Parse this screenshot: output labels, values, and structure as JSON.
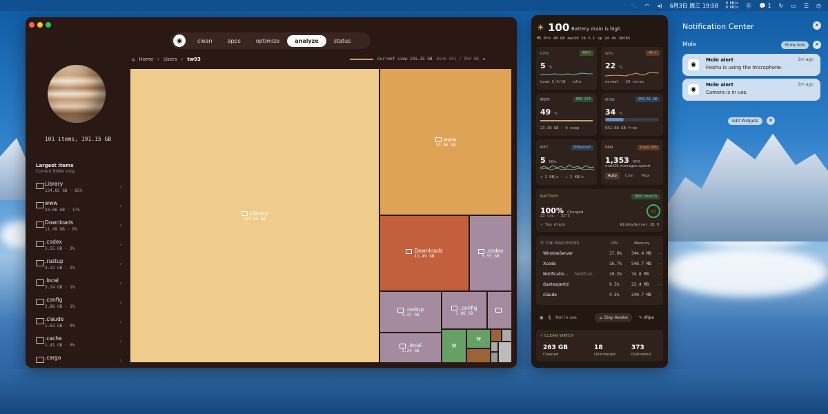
{
  "menubar": {
    "date": "6月3日 周三 19:58",
    "net_up": "0 KB/s",
    "net_down": "0 KB/s",
    "wechat_count": "1"
  },
  "window": {
    "tabs": [
      "clean",
      "apps",
      "optimize",
      "analyze",
      "status"
    ],
    "active_tab": "analyze",
    "summary": "101 items, 191.15 GB",
    "sidebar_heading": "Largest Items",
    "sidebar_sub": "Current folder only",
    "items": [
      {
        "name": "Library",
        "meta": "124.85 GB · 65%"
      },
      {
        "name": "www",
        "meta": "33.06 GB · 17%"
      },
      {
        "name": "Downloads",
        "meta": "11.49 GB · 6%"
      },
      {
        "name": ".codex",
        "meta": "5.55 GB · 2%"
      },
      {
        "name": ".rustup",
        "meta": "4.32 GB · 2%"
      },
      {
        "name": ".local",
        "meta": "3.24 GB · 1%"
      },
      {
        "name": ".config",
        "meta": "2.86 GB · 1%"
      },
      {
        "name": ".claude",
        "meta": "1.63 GB · 0%"
      },
      {
        "name": ".cache",
        "meta": "1.41 GB · 0%"
      },
      {
        "name": ".cargo",
        "meta": ""
      }
    ],
    "breadcrumb": [
      "Home",
      "Users",
      "tw93"
    ],
    "current_view": "Current view 191.15 GB",
    "disk": "Disk 341 / 994 GB",
    "treemap": [
      {
        "name": "Library",
        "size": "124.85 GB",
        "color": "#f0cc8c"
      },
      {
        "name": "www",
        "size": "33.06 GB",
        "color": "#dfa356"
      },
      {
        "name": "Downloads",
        "size": "11.49 GB",
        "color": "#c2603e"
      },
      {
        "name": ".codex",
        "size": "5.55 GB",
        "color": "#a48ba0"
      },
      {
        "name": ".rustup",
        "size": "4.32 GB",
        "color": "#a48ba0"
      },
      {
        "name": ".config",
        "size": "2.86 GB",
        "color": "#a48ba0"
      },
      {
        "name": ".local",
        "size": "3.24 GB",
        "color": "#a48ba0"
      }
    ]
  },
  "stats": {
    "battery_headline": "100",
    "battery_status": "Battery drain is high",
    "chips": [
      "M5 Pro",
      "48 GB",
      "macOS 26.5.1",
      "up 1d 4h",
      "SOCKS"
    ],
    "cpu": {
      "label": "CPU",
      "temp": "49°C",
      "value": "5",
      "unit": "%",
      "sub": "Load 3.4/18 · idle"
    },
    "gpu": {
      "label": "GPU",
      "temp": "45°C",
      "value": "22",
      "unit": "%",
      "sub": "normal · 20 cores"
    },
    "mem": {
      "label": "MEM",
      "badge": "PRS 17%",
      "value": "49",
      "unit": "%",
      "sub": "23.38 GB · 0 swap"
    },
    "disk": {
      "label": "DISK",
      "badge": "994.61 GB",
      "value": "34",
      "unit": "%",
      "sub": "652.68 GB free"
    },
    "net": {
      "label": "NET",
      "badge": "Ethernet",
      "value": "5",
      "unit": "KB/s",
      "sub": "↑ 2 KB/s · ↓ 2 KB/s"
    },
    "fan": {
      "label": "FAN",
      "badge": "Load 25%",
      "value": "1,353",
      "unit": "RPM",
      "sub": "macOS manages speed",
      "modes": [
        "Auto",
        "Cool",
        "Max"
      ]
    },
    "battery": {
      "label": "BATTERY",
      "badge": "100% Health",
      "value": "100%",
      "state": "Charged",
      "sub": "23 cyc · 31°C",
      "drain_label": "Top drain",
      "drain_value": "WindowServer 28.9"
    },
    "processes": {
      "label": "TOP PROCESSES",
      "col_cpu": "CPU",
      "col_mem": "Memory",
      "rows": [
        {
          "name": "WindowServer",
          "extra": "",
          "cpu": "37.9%",
          "mem": "344.4 MB"
        },
        {
          "name": "Xcode",
          "extra": "",
          "cpu": "16.7%",
          "mem": "548.7 MB"
        },
        {
          "name": "Notificatio...",
          "extra": "Notificat...",
          "cpu": "10.2%",
          "mem": "74.8 MB"
        },
        {
          "name": "duetexpertd",
          "extra": "",
          "cpu": "9.5%",
          "mem": "22.4 MB"
        },
        {
          "name": "claude",
          "extra": "",
          "cpu": "4.5%",
          "mem": "240.7 MB"
        }
      ]
    },
    "mic": "Not in use",
    "stay_awake": "Stay Awake",
    "wipe": "Wipe",
    "clean_watch": {
      "label": "CLEAN WATCH",
      "cleaned": "263 GB",
      "cleaned_label": "Cleaned",
      "uninstalled": "18",
      "uninstalled_label": "Uninstalled",
      "optimized": "373",
      "optimized_label": "Optimized"
    }
  },
  "notification_center": {
    "title": "Notification Center",
    "group": "Mole",
    "show_less": "Show less",
    "edit_widgets": "Edit Widgets",
    "notifications": [
      {
        "title": "Mole alert",
        "body": "Feishu is using the microphone.",
        "time": "2m ago"
      },
      {
        "title": "Mole alert",
        "body": "Camera is in use.",
        "time": "2m ago"
      }
    ]
  }
}
